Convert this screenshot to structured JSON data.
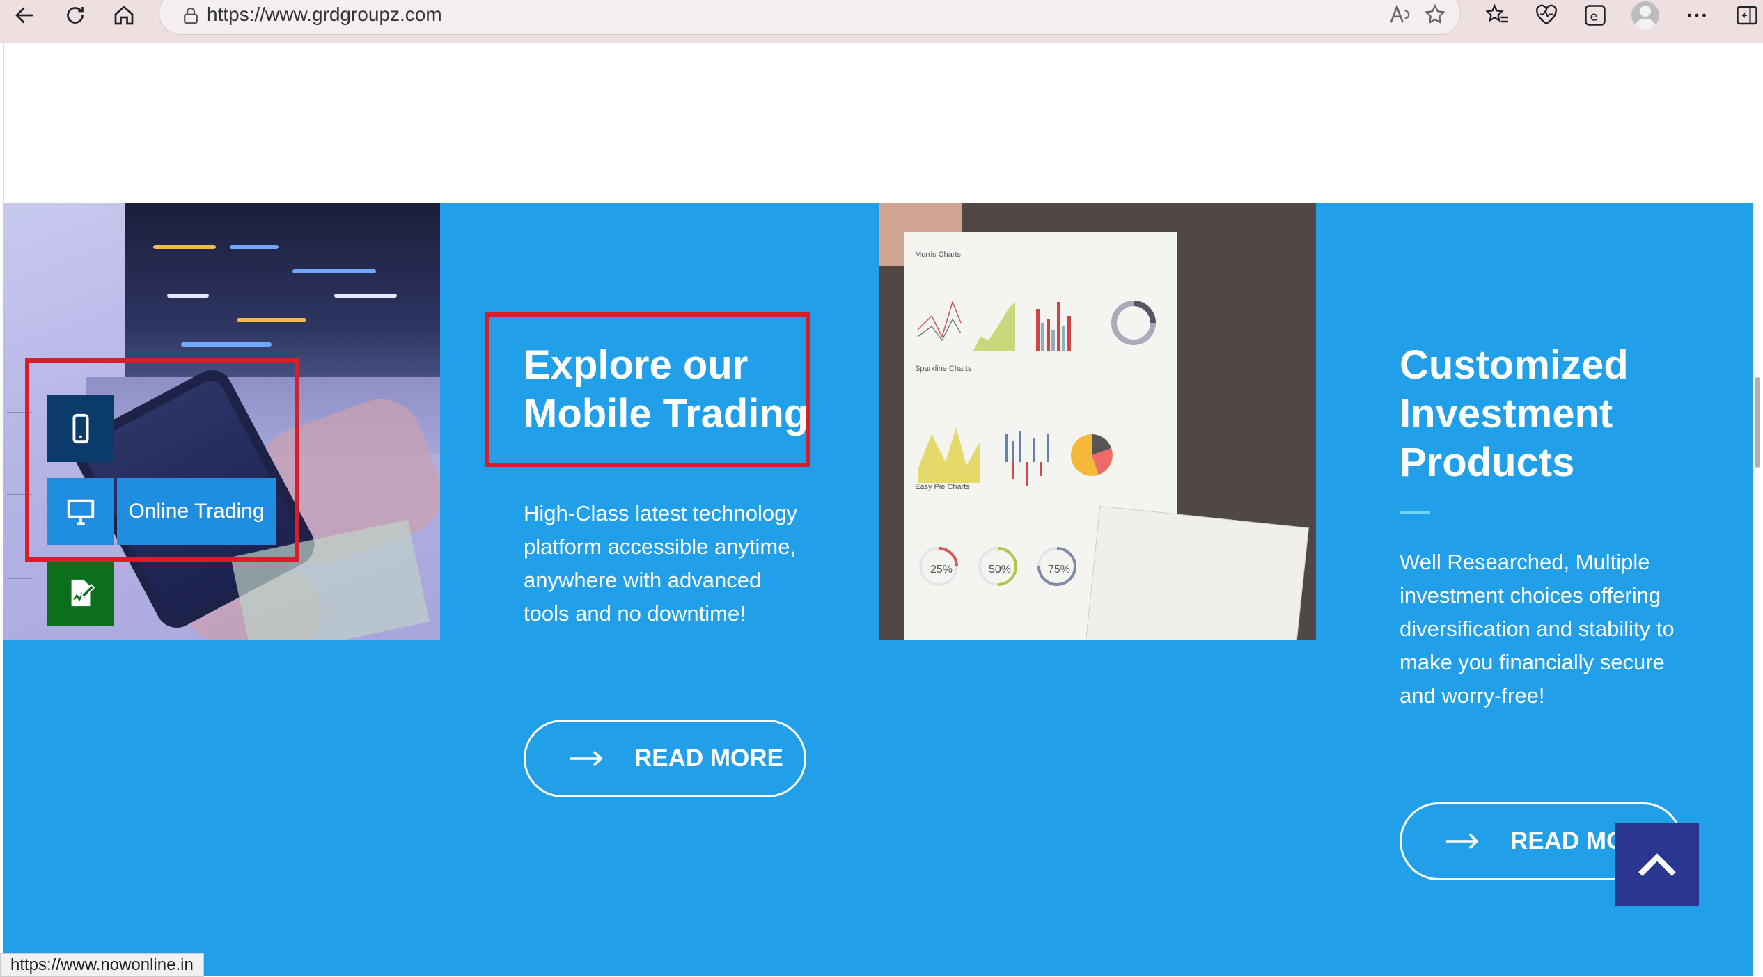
{
  "browser": {
    "url": "https://www.grdgroupz.com",
    "status_url": "https://www.nowonline.in"
  },
  "colors": {
    "band_blue": "#219fe8",
    "highlight_red": "#d81e2a",
    "back_to_top": "#2a3690",
    "icon_dark_blue": "#0a3b6b",
    "icon_green": "#0b6f1e"
  },
  "left_card": {
    "side_icons": [
      "mobile-icon",
      "desktop-icon",
      "signature-document-icon"
    ],
    "online_trading_label": "Online Trading"
  },
  "mobile_section": {
    "heading_line1": "Explore our",
    "heading_line2": "Mobile Trading",
    "body": "High-Class latest technology platform accessible anytime, anywhere with advanced tools and no downtime!",
    "cta": "READ MORE"
  },
  "chart_paper": {
    "labels": [
      "Morris Charts",
      "Sparkline Charts",
      "Easy Pie Charts"
    ],
    "pies": [
      "25%",
      "50%",
      "75%"
    ]
  },
  "investment_section": {
    "heading_line1": "Customized",
    "heading_line2": "Investment",
    "heading_line3": "Products",
    "body": "Well Researched, Multiple investment choices offering diversification and stability to make you financially secure and worry-free!",
    "cta": "READ MORE"
  }
}
